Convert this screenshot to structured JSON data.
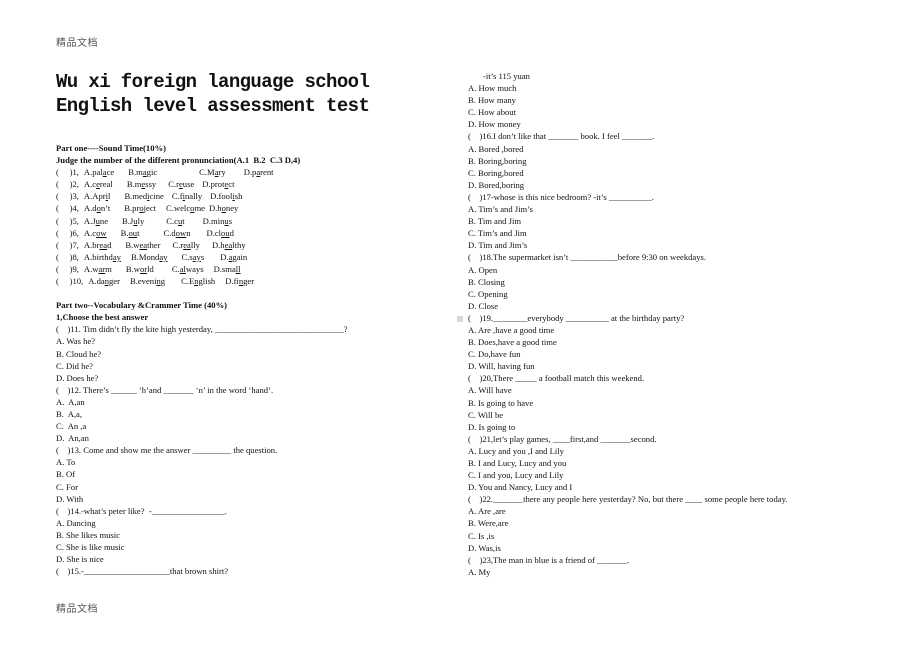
{
  "watermark": "精品文档",
  "title": "Wu xi foreign language school English level assessment test",
  "part_one": {
    "heading": "Part one----Sound Time(10%)",
    "instruction": "Judge the number of the different pronunciation(A.1  B.2  C.3 D,4)",
    "questions": [
      {
        "num": "1,",
        "options": [
          [
            "A.pal",
            "a",
            "ce"
          ],
          [
            "B.m",
            "a",
            "gic"
          ],
          [
            "C.M",
            "a",
            "ry"
          ],
          [
            "D.p",
            "a",
            "rent"
          ]
        ]
      },
      {
        "num": "2,",
        "options": [
          [
            "A.c",
            "e",
            "real"
          ],
          [
            "B.m",
            "e",
            "ssy"
          ],
          [
            "C.r",
            "e",
            "use"
          ],
          [
            "D.prot",
            "e",
            "ct"
          ]
        ]
      },
      {
        "num": "3,",
        "options": [
          [
            "A.Apr",
            "i",
            "l"
          ],
          [
            "B.med",
            "i",
            "cine"
          ],
          [
            "C.f",
            "i",
            "nally"
          ],
          [
            "D.fool",
            "i",
            "sh"
          ]
        ]
      },
      {
        "num": "4,",
        "options": [
          [
            "A.d",
            "o",
            "n’t"
          ],
          [
            "B.pr",
            "o",
            "ject"
          ],
          [
            "C.welc",
            "o",
            "me"
          ],
          [
            "D.h",
            "o",
            "ney"
          ]
        ]
      },
      {
        "num": "5,",
        "options": [
          [
            "A.J",
            "u",
            "ne"
          ],
          [
            "B.J",
            "u",
            "ly"
          ],
          [
            "C.c",
            "u",
            "t"
          ],
          [
            "D.min",
            "u",
            "s"
          ]
        ]
      },
      {
        "num": "6,",
        "options": [
          [
            "A.c",
            "ow",
            ""
          ],
          [
            "B.",
            "ou",
            "t"
          ],
          [
            "C.d",
            "ow",
            "n"
          ],
          [
            "D.cl",
            "ou",
            "d"
          ]
        ]
      },
      {
        "num": "7,",
        "options": [
          [
            "A.br",
            "ea",
            "d"
          ],
          [
            "B.w",
            "ea",
            "ther"
          ],
          [
            "C.r",
            "ea",
            "lly"
          ],
          [
            "D.h",
            "ea",
            "lthy"
          ]
        ]
      },
      {
        "num": "8,",
        "options": [
          [
            "A.birthd",
            "ay",
            ""
          ],
          [
            "B.Mond",
            "ay",
            ""
          ],
          [
            "C.s",
            "ay",
            "s"
          ],
          [
            "D.",
            "a",
            "gain"
          ]
        ]
      },
      {
        "num": "9,",
        "options": [
          [
            "A.w",
            "ar",
            "m"
          ],
          [
            "B.w",
            "or",
            "ld"
          ],
          [
            "C.",
            "al",
            "ways"
          ],
          [
            "D.sma",
            "ll",
            ""
          ]
        ]
      },
      {
        "num": "10,",
        "options": [
          [
            "A.da",
            "ng",
            "er"
          ],
          [
            "B.eveni",
            "ng",
            ""
          ],
          [
            "C.E",
            "ng",
            "lish"
          ],
          [
            "D.fi",
            "ng",
            "er"
          ]
        ]
      }
    ]
  },
  "part_two": {
    "heading": "Part two--Vocabulary &Crammer Time (40%)",
    "subheading": "1,Choose the best answer"
  },
  "left_lines": [
    "(    )11. Tim didn’t fly the kite high yesterday, ______________________________?",
    "A. Was he?",
    "B. Cloud he?",
    "C. Did he?",
    "D. Does he?",
    "(    )12. There’s ______ ‘h’and _______ ‘n’ in the word ‘hand’.",
    "A.  A,an",
    "B.  A,a,",
    "C.  An ,a",
    "D.  An,an",
    "(    )13. Come and show me the answer _________ the question.",
    "A. To",
    "B. Of",
    "C. For",
    "D. With",
    "(    )14.-what’s peter like?  -_________________.",
    "A. Dancing",
    "B. She likes music",
    "C. She is like music",
    "D. She is nice",
    "(    )15.-____________________that brown shirt?"
  ],
  "right_first_line": "-it’s 115 yuan",
  "right_lines": [
    "A. How much",
    "B. How many",
    "C. How about",
    "D. How money",
    "(    )16.I don’t like that _______ book. I feel _______.",
    "A. Bored ,bored",
    "B. Boring,boring",
    "C. Boring,bored",
    "D. Bored,boring",
    "(    )17-whose is this nice bedroom? -it’s __________.",
    "A. Tim’s and Jim’s",
    "B. Tim and Jim",
    "C. Tim’s and Jim",
    "D. Tim and Jim’s",
    "(    )18.The supermarket isn’t ___________before 9:30 on weekdays.",
    "A. Open",
    "B. Closing",
    "C. Opening",
    "D. Close",
    "(    )19.________everybody __________ at the birthday party?",
    "A. Are ,have a good time",
    "B. Does,have a good time",
    "C. Do,have fun",
    "D. Will, having fun",
    "(    )20,There _____ a football match this weekend.",
    "A. Will have",
    "B. Is going to have",
    "C. Will be",
    "D. Is going to",
    "(    )21,let’s play games, ____first,and _______second.",
    "A. Lucy and you ,I and Lily",
    "B. I and Lucy, Lucy and you",
    "C. I and you, Lucy and Lily",
    "D. You and Nancy, Lucy and I",
    "(    )22._______there any people here yesterday? No, but there ____ some people here today.",
    "A. Are ,are",
    "B. Were,are",
    "C. Is ,is",
    "D. Was,is",
    "(    )23,The man in blue is a friend of _______.",
    "A. My"
  ]
}
